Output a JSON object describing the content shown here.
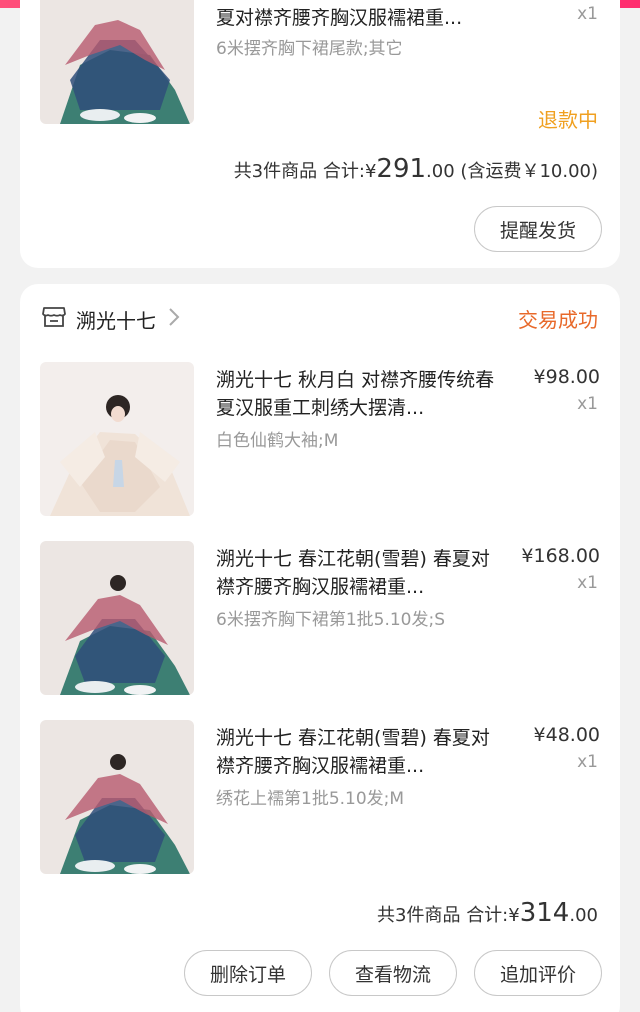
{
  "order1": {
    "product": {
      "title": "夏对襟齐腰齐胸汉服襦裙重...",
      "spec": "6米摆齐胸下裙尾款;其它",
      "qty": "x1"
    },
    "status": "退款中",
    "summary": {
      "count_label": "共3件商品",
      "total_label": "合计:",
      "currency": "¥",
      "total_int": "291",
      "total_dec": ".00",
      "shipping_note": "(含运费￥10.00)"
    },
    "button": "提醒发货"
  },
  "order2": {
    "shop_name": "溯光十七",
    "status": "交易成功",
    "products": [
      {
        "title": "溯光十七 秋月白 对襟齐腰传统春夏汉服重工刺绣大摆清...",
        "spec": "白色仙鹤大袖;M",
        "price": "¥98.00",
        "qty": "x1"
      },
      {
        "title": "溯光十七 春江花朝(雪碧) 春夏对襟齐腰齐胸汉服襦裙重...",
        "spec": "6米摆齐胸下裙第1批5.10发;S",
        "price": "¥168.00",
        "qty": "x1"
      },
      {
        "title": "溯光十七 春江花朝(雪碧) 春夏对襟齐腰齐胸汉服襦裙重...",
        "spec": "绣花上襦第1批5.10发;M",
        "price": "¥48.00",
        "qty": "x1"
      }
    ],
    "summary": {
      "count_label": "共3件商品",
      "total_label": "合计:",
      "currency": "¥",
      "total_int": "314",
      "total_dec": ".00"
    },
    "buttons": {
      "delete": "删除订单",
      "logistics": "查看物流",
      "review": "追加评价"
    }
  },
  "icons": {
    "shop": "store-icon",
    "chevron": "chevron-right-icon"
  },
  "colors": {
    "refund_status": "#f0a020",
    "trade_success": "#e8692a",
    "top_strip": "#ff2d6f"
  }
}
